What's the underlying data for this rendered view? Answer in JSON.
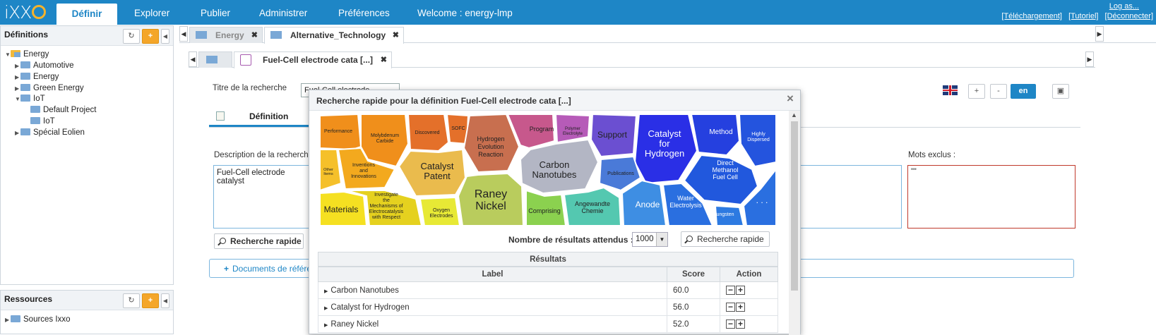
{
  "topbar": {
    "logo": "iXXO",
    "nav": [
      "Définir",
      "Explorer",
      "Publier",
      "Administrer",
      "Préférences"
    ],
    "welcome": "Welcome : energy-lmp",
    "links": {
      "login": "Log as...",
      "download": "[Téléchargement]",
      "tutorial": "[Tutoriel]",
      "logout": "[Déconnecter]"
    }
  },
  "definitions_panel": {
    "title": "Définitions",
    "tree": [
      "Energy",
      "Automotive",
      "Energy",
      "Green Energy",
      "IoT",
      "Default Project",
      "IoT",
      "Spécial Eolien"
    ]
  },
  "resources_panel": {
    "title": "Ressources",
    "first_item": "Sources Ixxo"
  },
  "tabs": {
    "outer": [
      "Energy",
      "Alternative_Technology"
    ],
    "inner": "Fuel-Cell electrode cata [...]"
  },
  "form": {
    "title_label": "Titre de la recherche",
    "title_value": "Fuel-Cell electrode catalyst",
    "subtab": "Définition",
    "description_label": "Description de la recherche",
    "description_value": "Fuel-Cell electrode catalyst",
    "excluded_label": "Mots exclus :",
    "excluded_value": "\"\"",
    "quick_search": "Recherche rapide",
    "ref_docs": "Documents de référence",
    "lang_plus": "+",
    "lang_minus": "-",
    "lang": "en"
  },
  "modal": {
    "title": "Recherche rapide pour la définition Fuel-Cell electrode cata [...]",
    "close": "×",
    "results_count_label": "Nombre de résultats attendus :",
    "results_count": "1000",
    "quick_search": "Recherche rapide",
    "results_title": "Résultats",
    "columns": [
      "Label",
      "Score",
      "Action"
    ],
    "rows": [
      {
        "label": "Carbon Nanotubes",
        "score": "60.0"
      },
      {
        "label": "Catalyst for Hydrogen",
        "score": "56.0"
      },
      {
        "label": "Raney Nickel",
        "score": "52.0"
      }
    ],
    "voronoi": [
      {
        "label": "Performance",
        "color": "#f08f1b"
      },
      {
        "label": "Molybdenum Carbide",
        "color": "#f08f1b"
      },
      {
        "label": "Discovered",
        "color": "#e4702a"
      },
      {
        "label": "SOFC",
        "color": "#e4702a"
      },
      {
        "label": "Hydrogen Evolution Reaction",
        "color": "#c86f4f"
      },
      {
        "label": "Program",
        "color": "#c7588c"
      },
      {
        "label": "Polymer Electrolyte",
        "color": "#b65bb8"
      },
      {
        "label": "Support",
        "color": "#6b4fd1"
      },
      {
        "label": "Catalyst for Hydrogen",
        "color": "#2a2fe6"
      },
      {
        "label": "Method",
        "color": "#2540df"
      },
      {
        "label": "Highly Dispersed",
        "color": "#2454de"
      },
      {
        "label": "Other Items",
        "color": "#f5c02a"
      },
      {
        "label": "Inventions and Innovations",
        "color": "#f3a91e"
      },
      {
        "label": "Catalyst Patent",
        "color": "#eabb4d"
      },
      {
        "label": "Carbon Nanotubes",
        "color": "#b3b6c4"
      },
      {
        "label": "Publications",
        "color": "#4a7ad8"
      },
      {
        "label": "Direct Methanol Fuel Cell",
        "color": "#2158dd"
      },
      {
        "label": "Materials",
        "color": "#f5e021"
      },
      {
        "label": "Investigate the Mechanisms of Electrocatalysis with Respect",
        "color": "#e5d11f"
      },
      {
        "label": "Oxygen Electrodes",
        "color": "#e7e935"
      },
      {
        "label": "Raney Nickel",
        "color": "#b9cc5d"
      },
      {
        "label": "Comprising",
        "color": "#8bd14f"
      },
      {
        "label": "Angewandte Chemie",
        "color": "#54c8b0"
      },
      {
        "label": "Anode",
        "color": "#3e8ee3"
      },
      {
        "label": "Water Electrolysis",
        "color": "#2a6fe0"
      },
      {
        "label": "Tungsten",
        "color": "#2d7ae1"
      },
      {
        "label": ". . .",
        "color": "#2a6fe0"
      }
    ]
  }
}
